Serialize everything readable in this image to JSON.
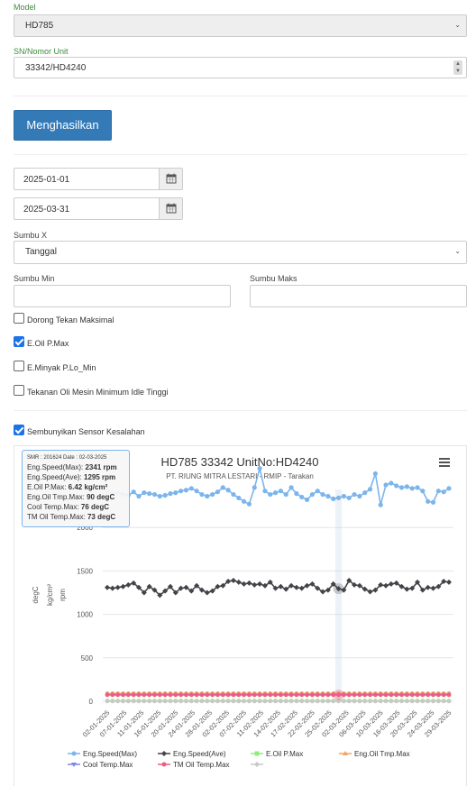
{
  "form": {
    "model_label": "Model",
    "model_value": "HD785",
    "sn_label": "SN/Nomor Unit",
    "sn_value": "33342/HD4240",
    "generate_button": "Menghasilkan",
    "start_date": "2025-01-01",
    "end_date": "2025-03-31",
    "x_axis_label": "Sumbu X",
    "x_axis_value": "Tanggal",
    "axis_min_label": "Sumbu Min",
    "axis_max_label": "Sumbu Maks",
    "axis_min_value": "",
    "axis_max_value": ""
  },
  "checkboxes": [
    {
      "label": "Dorong Tekan Maksimal",
      "checked": false
    },
    {
      "label": "E.Oil P.Max",
      "checked": true
    },
    {
      "label": "E.Minyak P.Lo_Min",
      "checked": false
    },
    {
      "label": "Tekanan Oli Mesin Minimum Idle Tinggi",
      "checked": false
    },
    {
      "label": "Sembunyikan Sensor Kesalahan",
      "checked": true
    }
  ],
  "tooltip": {
    "header": "SMR : 201624 Date : 02-03-2025",
    "rows": [
      {
        "label": "Eng.Speed(Max):",
        "value": "2341 rpm"
      },
      {
        "label": "Eng.Speed(Ave):",
        "value": "1295 rpm"
      },
      {
        "label": "E.Oil P.Max:",
        "value": "6.42 kg/cm²"
      },
      {
        "label": "Eng.Oil Tmp.Max:",
        "value": "90 degC"
      },
      {
        "label": "Cool Temp.Max:",
        "value": "76 degC"
      },
      {
        "label": "TM Oil Temp.Max:",
        "value": "73 degC"
      }
    ]
  },
  "chart_data": {
    "type": "line",
    "title": "HD785 33342 UnitNo:HD4240",
    "subtitle": "PT. RIUNG MITRA LESTARI - RMIP - Tarakan",
    "ylabels": [
      "degC",
      "kg/cm²",
      "rpm"
    ],
    "ylim": [
      0,
      2500
    ],
    "yticks": [
      0,
      500,
      1000,
      1500,
      2000
    ],
    "x_tick_labels": [
      "02-01-2025",
      "07-01-2025",
      "11-01-2025",
      "16-01-2025",
      "20-01-2025",
      "24-01-2025",
      "28-01-2025",
      "02-02-2025",
      "07-02-2025",
      "11-02-2025",
      "14-02-2025",
      "17-02-2025",
      "22-02-2025",
      "25-02-2025",
      "02-03-2025",
      "06-03-2025",
      "10-03-2025",
      "16-03-2025",
      "20-03-2025",
      "24-03-2025",
      "29-03-2025"
    ],
    "highlight_index": 44,
    "series": [
      {
        "name": "Eng.Speed(Max)",
        "color": "#7cb5ec",
        "marker": "circle",
        "values": [
          2420,
          2390,
          2400,
          2380,
          2370,
          2410,
          2360,
          2400,
          2390,
          2380,
          2360,
          2370,
          2390,
          2400,
          2420,
          2430,
          2450,
          2420,
          2380,
          2360,
          2380,
          2410,
          2460,
          2430,
          2380,
          2340,
          2300,
          2270,
          2460,
          2680,
          2420,
          2380,
          2400,
          2420,
          2380,
          2460,
          2390,
          2350,
          2320,
          2380,
          2420,
          2380,
          2360,
          2330,
          2341,
          2360,
          2340,
          2380,
          2360,
          2400,
          2440,
          2620,
          2260,
          2490,
          2510,
          2480,
          2460,
          2470,
          2450,
          2460,
          2420,
          2300,
          2290,
          2420,
          2410,
          2450
        ]
      },
      {
        "name": "Eng.Speed(Ave)",
        "color": "#434348",
        "marker": "diamond",
        "values": [
          1310,
          1300,
          1310,
          1320,
          1340,
          1360,
          1310,
          1250,
          1320,
          1280,
          1220,
          1270,
          1320,
          1250,
          1300,
          1310,
          1270,
          1330,
          1280,
          1250,
          1270,
          1320,
          1330,
          1380,
          1390,
          1370,
          1350,
          1360,
          1340,
          1350,
          1330,
          1370,
          1300,
          1320,
          1290,
          1330,
          1310,
          1300,
          1330,
          1350,
          1300,
          1260,
          1280,
          1350,
          1295,
          1280,
          1390,
          1340,
          1330,
          1290,
          1260,
          1280,
          1340,
          1330,
          1350,
          1360,
          1320,
          1290,
          1300,
          1370,
          1280,
          1310,
          1300,
          1320,
          1380,
          1370
        ]
      },
      {
        "name": "E.Oil P.Max",
        "color": "#90ed7d",
        "marker": "square",
        "values": [
          6.5,
          6.4,
          6.5,
          6.4,
          6.5,
          6.4,
          6.5,
          6.4,
          6.5,
          6.4,
          6.5,
          6.4,
          6.5,
          6.4,
          6.5,
          6.4,
          6.5,
          6.4,
          6.5,
          6.4,
          6.5,
          6.4,
          6.5,
          6.4,
          6.5,
          6.4,
          6.5,
          6.4,
          6.5,
          6.4,
          6.5,
          6.4,
          6.5,
          6.4,
          6.5,
          6.4,
          6.5,
          6.4,
          6.5,
          6.4,
          6.5,
          6.4,
          6.5,
          6.4,
          6.42,
          6.4,
          6.5,
          6.4,
          6.5,
          6.4,
          6.5,
          6.4,
          6.5,
          6.4,
          6.5,
          6.4,
          6.5,
          6.4,
          6.5,
          6.4,
          6.5,
          6.4,
          6.5,
          6.4,
          6.5,
          6.4
        ]
      },
      {
        "name": "Eng.Oil Tmp.Max",
        "color": "#f7a35c",
        "marker": "triangle",
        "value_constant": 90
      },
      {
        "name": "Cool Temp.Max",
        "color": "#8085e9",
        "marker": "triangle-down",
        "value_constant": 76
      },
      {
        "name": "TM Oil Temp.Max",
        "color": "#f15c80",
        "marker": "circle",
        "value_constant": 73
      },
      {
        "name": "",
        "color": "#c8c8c8",
        "marker": "diamond",
        "value_constant": 0
      }
    ],
    "legend_position": "bottom"
  }
}
